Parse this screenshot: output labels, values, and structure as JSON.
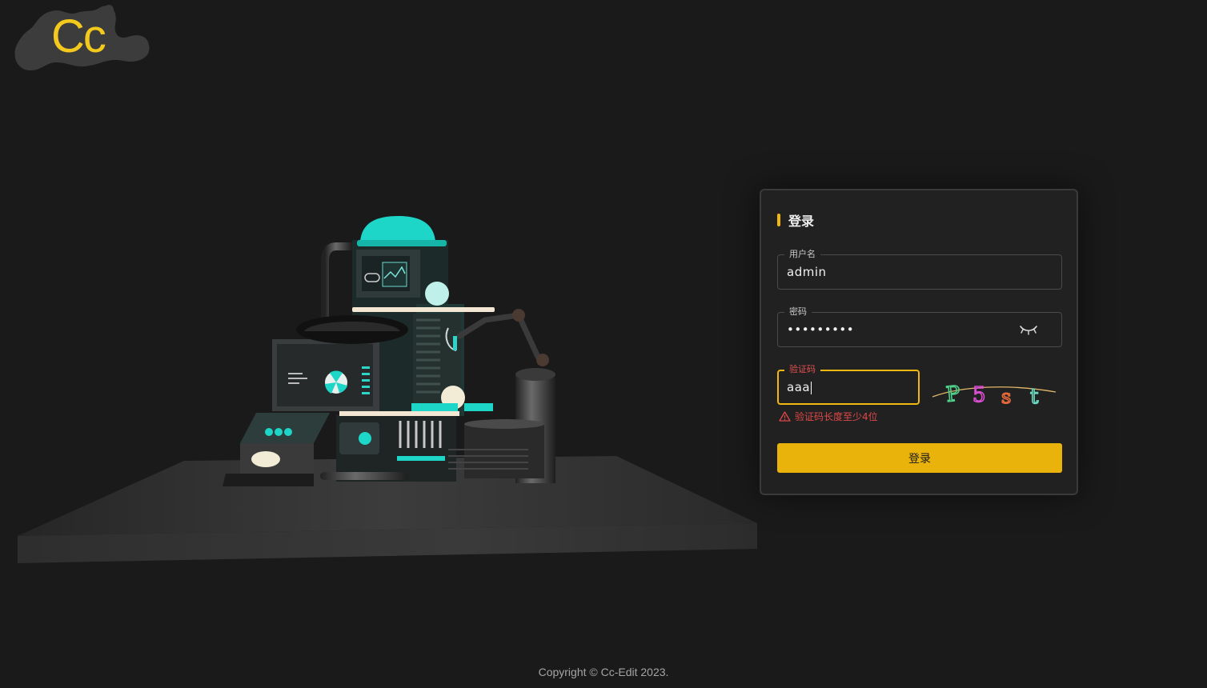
{
  "logo": {
    "text": "Cc",
    "color": "#f3c91d"
  },
  "login": {
    "title": "登录",
    "username": {
      "label": "用户名",
      "value": "admin"
    },
    "password": {
      "label": "密码",
      "value": "•••••••••"
    },
    "captcha": {
      "label": "验证码",
      "value": "aaa",
      "image_text": "P5st",
      "error": "验证码长度至少4位"
    },
    "submit_label": "登录"
  },
  "footer": {
    "copyright": "Copyright © Cc-Edit 2023."
  },
  "colors": {
    "accent": "#eab30c",
    "error": "#e04848",
    "teal": "#2ed4c8",
    "background": "#1a1a1a"
  }
}
